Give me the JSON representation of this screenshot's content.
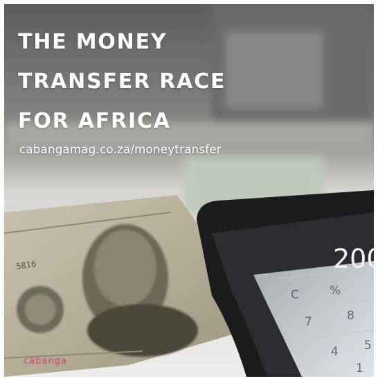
{
  "post": {
    "title_lines": [
      "THE MONEY",
      "TRANSFER RACE",
      "FOR AFRICA"
    ],
    "url": "cabangamag.co.za/moneytransfer",
    "logo_text": "cabanga",
    "calculator_display": "200",
    "calculator_keys": [
      "C",
      "%",
      "7",
      "8",
      "4",
      "5",
      "1"
    ],
    "banknote_serial": "5816"
  },
  "colors": {
    "text": "#ffffff",
    "logo": "#cf3b5a",
    "background": "#e9e7e4"
  }
}
